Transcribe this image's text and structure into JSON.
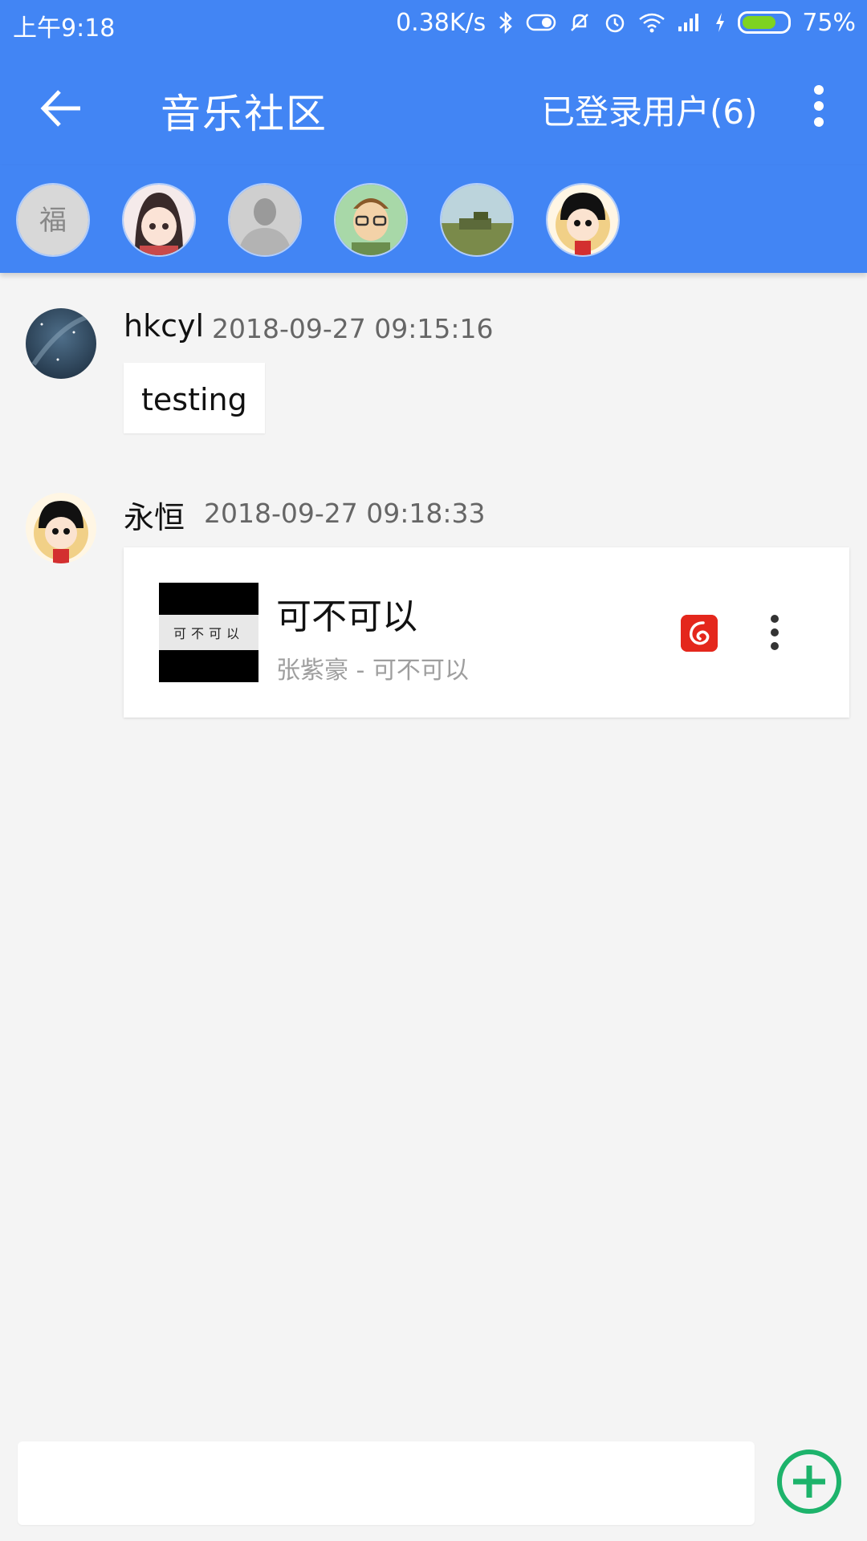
{
  "status_bar": {
    "time": "上午9:18",
    "net_speed": "0.38K/s",
    "battery": "75%",
    "battery_level": 0.75,
    "icons": [
      "bluetooth-icon",
      "toggle-icon",
      "mute-icon",
      "alarm-icon",
      "wifi-icon",
      "signal-icon",
      "charging-icon"
    ]
  },
  "app_bar": {
    "title": "音乐社区",
    "logged_users": "已登录用户(6)",
    "back_icon": "arrow-left-icon",
    "more_icon": "more-vert-icon"
  },
  "online_avatars": [
    {
      "name": "avatar-1"
    },
    {
      "name": "avatar-2"
    },
    {
      "name": "avatar-3"
    },
    {
      "name": "avatar-4"
    },
    {
      "name": "avatar-5"
    },
    {
      "name": "avatar-6"
    }
  ],
  "messages": [
    {
      "user": "hkcyl",
      "time": "2018-09-27 09:15:16",
      "text": "testing"
    },
    {
      "user": "永恒",
      "time": "2018-09-27 09:18:33",
      "song": {
        "title": "可不可以",
        "subtitle": "张紫豪 - 可不可以",
        "cover_text": "可不可以",
        "source_icon": "netease-music-icon"
      }
    }
  ],
  "composer": {
    "placeholder": "",
    "add_icon": "add-circle-icon"
  },
  "colors": {
    "primary": "#4285f4",
    "background": "#f4f4f4",
    "add_button": "#1db36b",
    "netease_red": "#e4271c"
  }
}
